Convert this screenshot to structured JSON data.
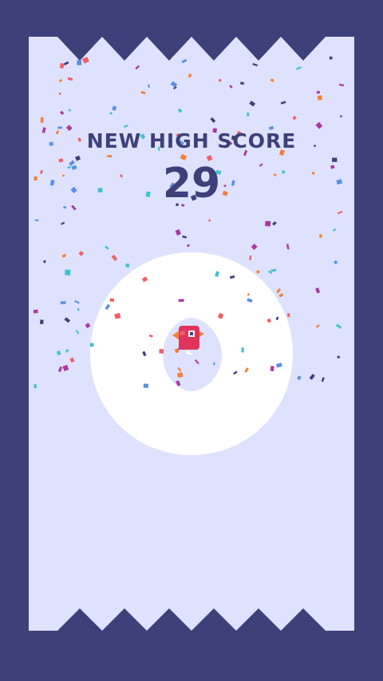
{
  "game": {
    "banner": "NEW HIGH SCORE",
    "score": "29"
  },
  "colors": {
    "frame": "#3d4079",
    "paper": "#dfe2ff",
    "ring": "#ffffff",
    "text": "#3d4079",
    "player_body": "#e0345a",
    "player_wing": "#f0803c",
    "confetti": [
      "#f0803c",
      "#3ec3c9",
      "#a93aa0",
      "#5a8fe0",
      "#3d4079",
      "#ef5f6a"
    ]
  },
  "icons": {
    "player": "box-bird-icon",
    "confetti": "confetti-particles"
  }
}
